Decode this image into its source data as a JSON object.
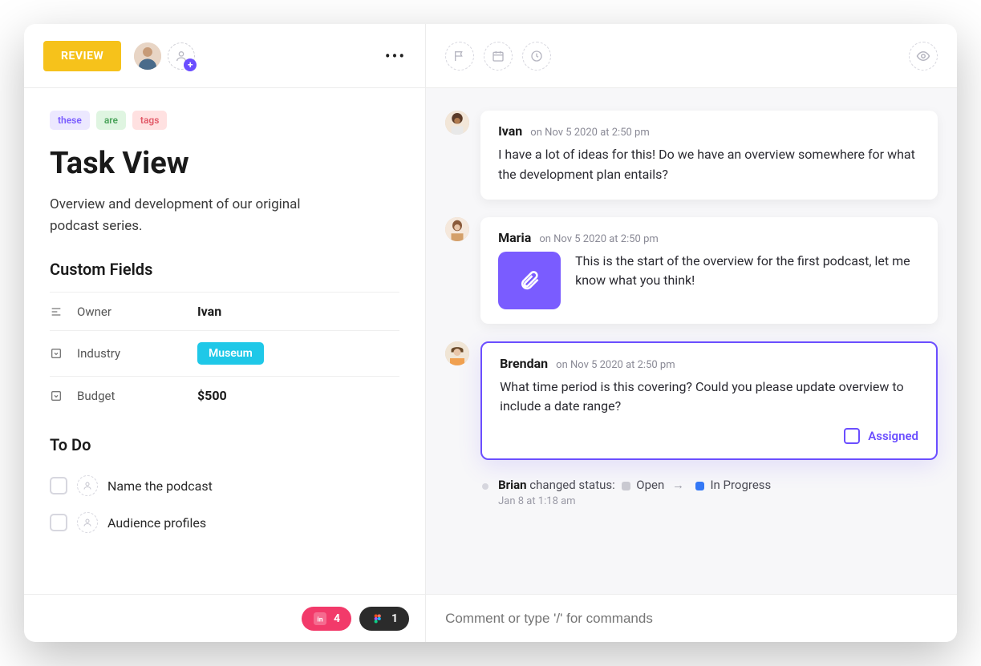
{
  "header": {
    "status": "REVIEW"
  },
  "tags": [
    "these",
    "are",
    "tags"
  ],
  "tag_colors": [
    "purple",
    "green",
    "red"
  ],
  "title": "Task View",
  "description": "Overview and development of our original podcast series.",
  "custom_fields": {
    "heading": "Custom Fields",
    "items": [
      {
        "label": "Owner",
        "value": "Ivan",
        "type": "text"
      },
      {
        "label": "Industry",
        "value": "Museum",
        "type": "badge"
      },
      {
        "label": "Budget",
        "value": "$500",
        "type": "text"
      }
    ]
  },
  "todo": {
    "heading": "To Do",
    "items": [
      {
        "text": "Name the podcast"
      },
      {
        "text": "Audience profiles"
      }
    ]
  },
  "comments": [
    {
      "author": "Ivan",
      "timestamp": "on Nov 5 2020 at 2:50 pm",
      "body": "I have a lot of ideas for this! Do we have an overview somewhere for what the development plan entails?"
    },
    {
      "author": "Maria",
      "timestamp": "on Nov 5 2020 at 2:50 pm",
      "body": "This is the start of the overview for the first podcast, let me know what you think!",
      "attachment_icon": "paperclip"
    },
    {
      "author": "Brendan",
      "timestamp": "on Nov 5 2020 at 2:50 pm",
      "body": "What time period is this covering? Could you please update overview to include a date range?",
      "assigned_label": "Assigned",
      "highlight": true
    }
  ],
  "activity": {
    "actor": "Brian",
    "action": "changed status:",
    "from": "Open",
    "to": "In Progress",
    "timestamp": "Jan 8 at 1:18 am"
  },
  "attachments": {
    "invision_count": "4",
    "figma_count": "1"
  },
  "composer": {
    "placeholder": "Comment or type '/' for commands"
  }
}
